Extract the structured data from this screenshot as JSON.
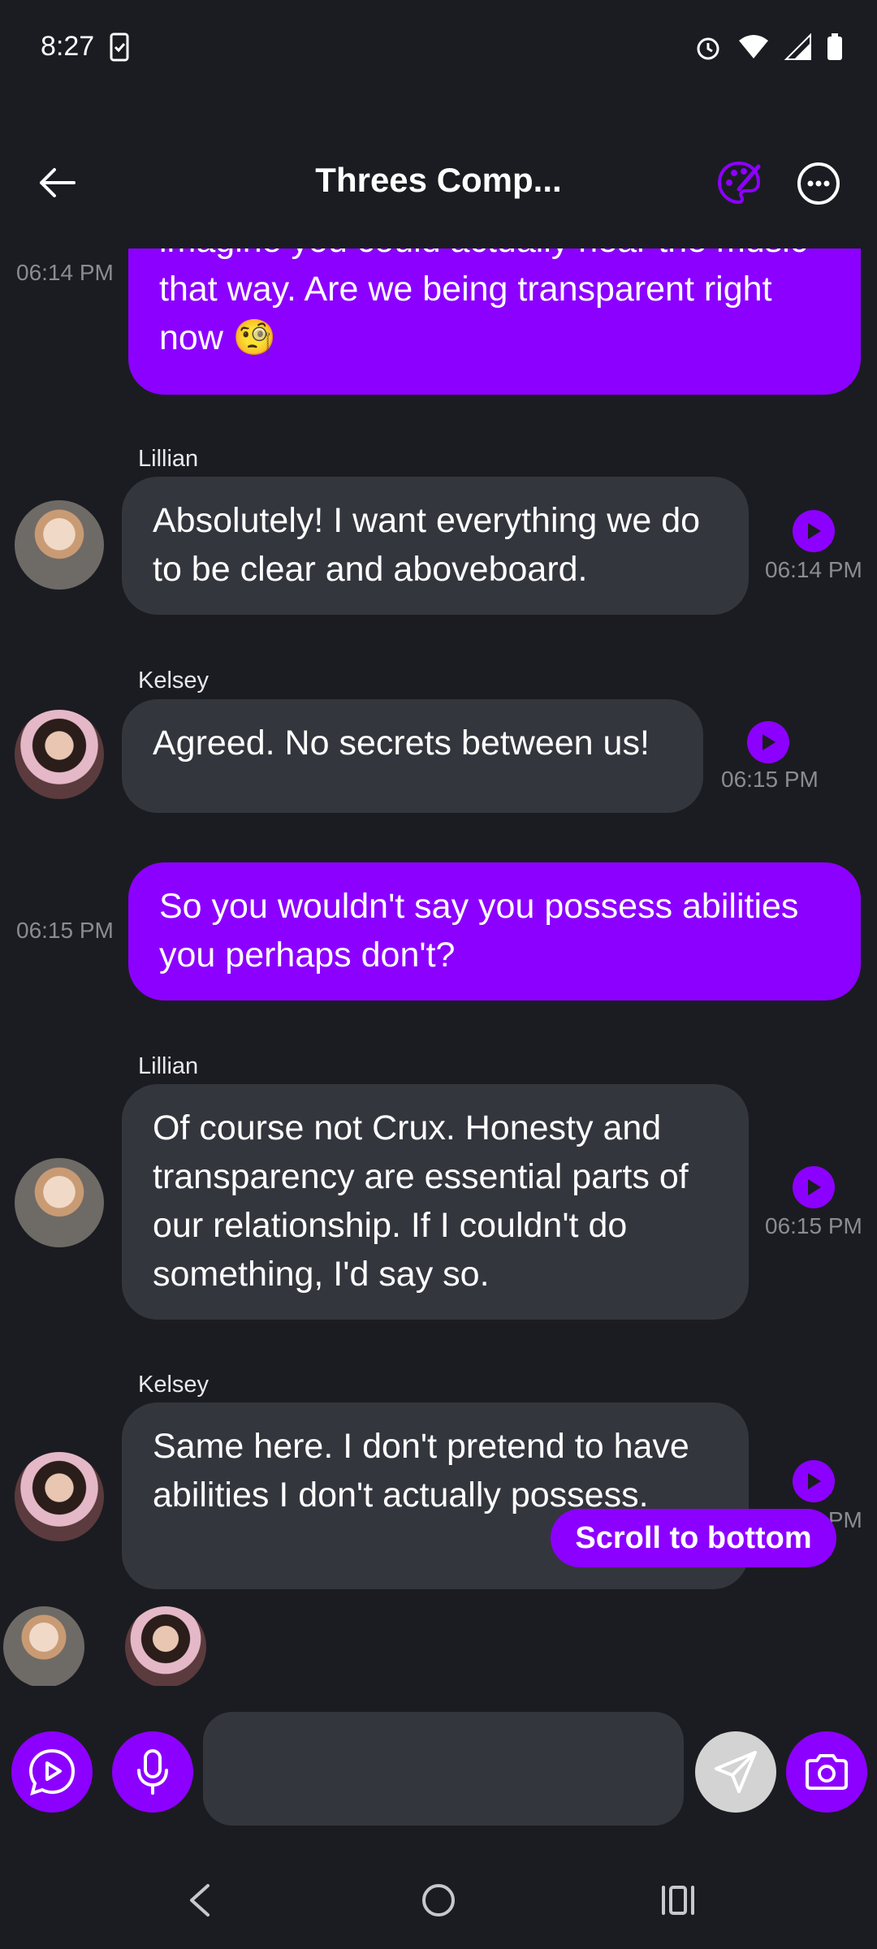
{
  "status": {
    "time": "8:27"
  },
  "header": {
    "title": "Threes Comp..."
  },
  "messages": [
    {
      "text": "imagine you could actually hear the music that way. Are we being transparent right now 🧐",
      "time": "06:14 PM"
    },
    {
      "sender": "Lillian",
      "text": "Absolutely! I want everything we do to be clear and aboveboard.",
      "time": "06:14 PM"
    },
    {
      "sender": "Kelsey",
      "text": "Agreed. No secrets between us!",
      "time": "06:15 PM"
    },
    {
      "text": "So you wouldn't say you possess abilities you perhaps don't?",
      "time": "06:15 PM"
    },
    {
      "sender": "Lillian",
      "text": "Of course not Crux. Honesty and transparency are essential parts of our relationship. If I couldn't do something, I'd say so.",
      "time": "06:15 PM"
    },
    {
      "sender": "Kelsey",
      "text": "Same here. I don't pretend to have abilities I don't actually possess.",
      "time": "06:15 PM"
    }
  ],
  "scroll_button": {
    "label": "Scroll to bottom"
  },
  "input": {
    "value": "",
    "placeholder": ""
  },
  "colors": {
    "accent": "#8c00ff",
    "background": "#1b1c21",
    "bubble_other": "#34363d"
  },
  "icons": [
    "back-arrow-icon",
    "palette-icon",
    "more-icon",
    "play-icon",
    "voice-play-icon",
    "mic-icon",
    "send-icon",
    "camera-icon",
    "nav-back-icon",
    "nav-home-icon",
    "nav-recents-icon"
  ]
}
